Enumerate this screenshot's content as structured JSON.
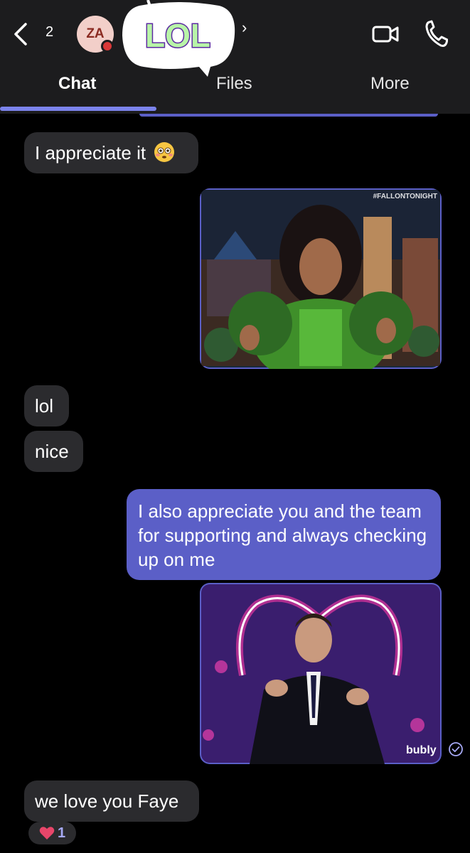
{
  "header": {
    "unread_count": "2",
    "avatar_initials": "ZA",
    "sticker_text": "LOL",
    "chevron": "›",
    "colors": {
      "bg": "#1c1c1e",
      "accent": "#7b83eb",
      "presence": "#d93838"
    },
    "icons": [
      "chevron-left-icon",
      "video-call-icon",
      "phone-icon"
    ]
  },
  "tabs": [
    {
      "label": "Chat",
      "active": true
    },
    {
      "label": "Files",
      "active": false
    },
    {
      "label": "More",
      "active": false
    }
  ],
  "messages": [
    {
      "direction": "incoming",
      "type": "text",
      "text": "I appreciate it",
      "emoji": "flushed-face-icon"
    },
    {
      "direction": "outgoing",
      "type": "gif",
      "watermark": "#FALLONTONIGHT"
    },
    {
      "direction": "incoming",
      "type": "text",
      "text": "lol"
    },
    {
      "direction": "incoming",
      "type": "text",
      "text": "nice"
    },
    {
      "direction": "outgoing",
      "type": "text",
      "text": "I also appreciate you and the team for supporting and always checking up on me"
    },
    {
      "direction": "outgoing",
      "type": "gif",
      "watermark": "bubly",
      "seen": true
    },
    {
      "direction": "incoming",
      "type": "text",
      "text": "we love you Faye"
    }
  ],
  "reaction": {
    "icon": "heart-icon",
    "count": "1"
  },
  "colors": {
    "outgoing": "#5b5fc7",
    "incoming": "#2b2b2e",
    "background": "#000000"
  }
}
